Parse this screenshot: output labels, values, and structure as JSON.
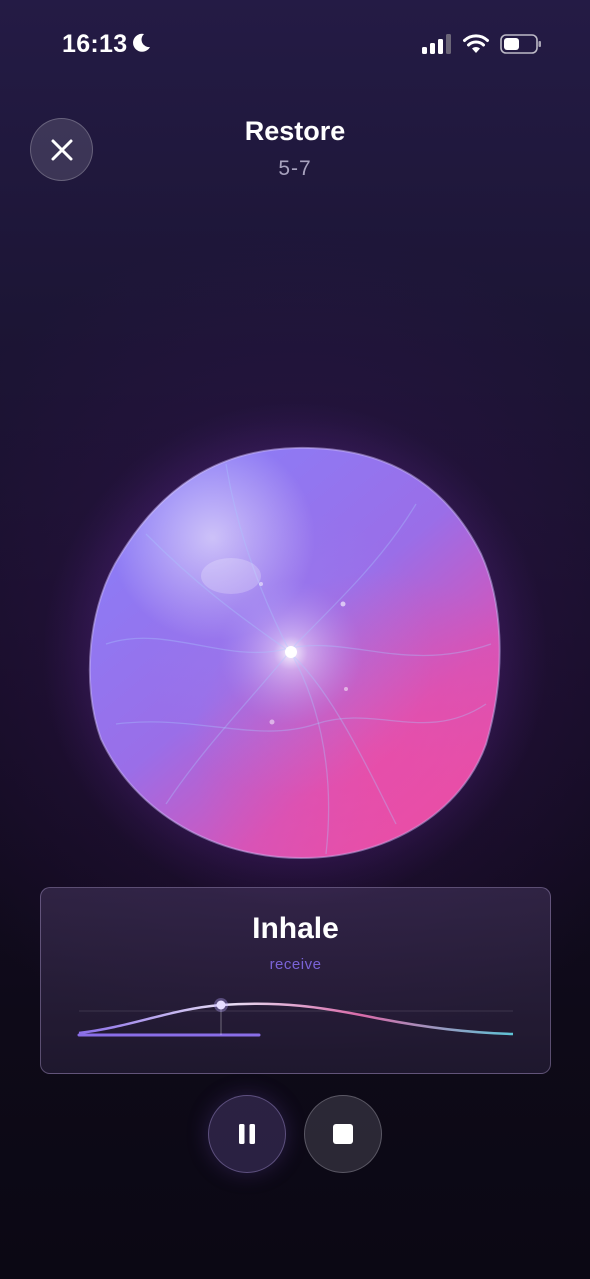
{
  "status_bar": {
    "time": "16:13",
    "icons": [
      "moon-icon",
      "cellular-signal-icon",
      "wifi-icon",
      "battery-icon"
    ]
  },
  "header": {
    "close_icon": "close-icon",
    "title": "Restore",
    "subtitle": "5-7"
  },
  "orb": {
    "colors": [
      "#7c6cf5",
      "#b06ae8",
      "#e04aa6"
    ]
  },
  "phase": {
    "label": "Inhale",
    "sublabel": "receive",
    "progress": 0.33
  },
  "controls": {
    "pause_icon": "pause-icon",
    "stop_icon": "stop-icon"
  },
  "colors": {
    "accent": "#7a63d6",
    "teal": "#37b6c7",
    "pink": "#e04aa6"
  }
}
